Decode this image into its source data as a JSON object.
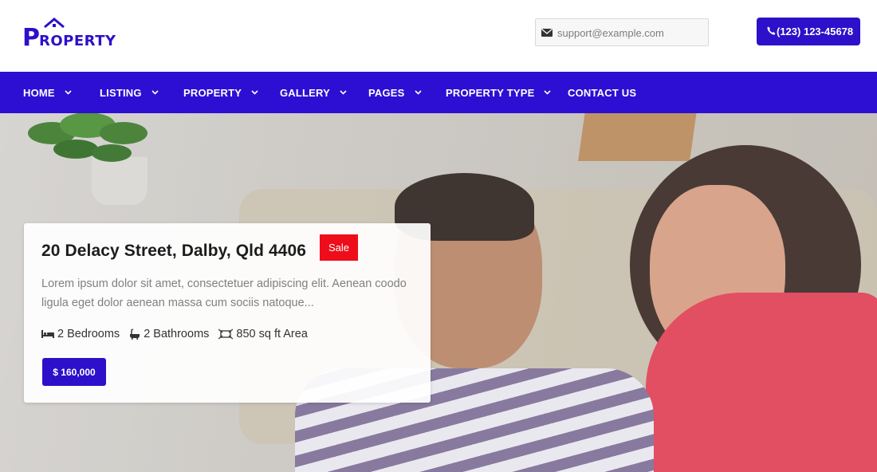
{
  "header": {
    "logo_first_letter": "P",
    "logo_rest": "ROPERTY",
    "email": "support@example.com",
    "phone": "(123) 123-45678"
  },
  "nav": {
    "items": [
      {
        "label": "HOME",
        "has_dropdown": true
      },
      {
        "label": "LISTING",
        "has_dropdown": true
      },
      {
        "label": "PROPERTY",
        "has_dropdown": true
      },
      {
        "label": "GALLERY",
        "has_dropdown": true
      },
      {
        "label": "PAGES",
        "has_dropdown": true
      },
      {
        "label": "PROPERTY TYPE",
        "has_dropdown": true
      },
      {
        "label": "CONTACT US",
        "has_dropdown": false
      }
    ]
  },
  "listing": {
    "title": "20 Delacy Street, Dalby, Qld 4406",
    "badge": "Sale",
    "description": "Lorem ipsum dolor sit amet, consectetuer adipiscing elit. Aenean coodo ligula eget dolor aenean massa cum sociis natoque...",
    "features": {
      "bedrooms": "2 Bedrooms",
      "bathrooms": "2 Bathrooms",
      "area": "850 sq ft Area"
    },
    "price": "$ 160,000"
  },
  "icons": {
    "email": "envelope-icon",
    "phone": "phone-icon",
    "bedrooms": "bed-icon",
    "bathrooms": "bathtub-icon",
    "area": "area-icon",
    "dropdown": "chevron-down-icon"
  },
  "colors": {
    "brand": "#2d10c9",
    "nav_bg": "#2d0fd3",
    "sale_badge": "#ee0d1a"
  }
}
